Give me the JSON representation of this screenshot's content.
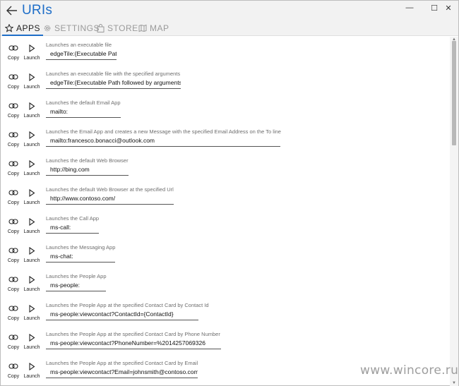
{
  "app": {
    "title": "URIs"
  },
  "window_controls": {
    "minimize": "—",
    "maximize": "☐",
    "close": "✕"
  },
  "tabs": [
    {
      "label": "APPS",
      "icon": "star-icon",
      "active": true
    },
    {
      "label": "SETTINGS",
      "icon": "gear-icon",
      "active": false
    },
    {
      "label": "STORE",
      "icon": "bag-icon",
      "active": false
    },
    {
      "label": "MAP",
      "icon": "map-icon",
      "active": false
    }
  ],
  "actions": {
    "copy_label": "Copy",
    "launch_label": "Launch"
  },
  "items": [
    {
      "description": "Launches an executable file",
      "uri": "edgeTile:{Executable Path}"
    },
    {
      "description": "Launches an executable file with the specified arguments",
      "uri": "edgeTile:{Executable Path followed by arguments}"
    },
    {
      "description": "Launches the default Email App",
      "uri": "mailto:"
    },
    {
      "description": "Launches the Email App and creates a new Message with the specified Email Address on the To line",
      "uri": "mailto:francesco.bonacci@outlook.com"
    },
    {
      "description": "Launches the default Web Browser",
      "uri": "http://bing.com"
    },
    {
      "description": "Launches the default Web Browser at the specified Url",
      "uri": "http://www.contoso.com/"
    },
    {
      "description": "Launches the Call App",
      "uri": "ms-call:"
    },
    {
      "description": "Launches the Messaging App",
      "uri": "ms-chat:"
    },
    {
      "description": "Launches the People App",
      "uri": "ms-people:"
    },
    {
      "description": "Launches the People App at the specified Contact Card by Contact Id",
      "uri": "ms-people:viewcontact?ContactId={ContactId}"
    },
    {
      "description": "Launches the People App at the specified Contact Card by Phone Number",
      "uri": "ms-people:viewcontact?PhoneNumber=%2014257069326"
    },
    {
      "description": "Launches the People App at the specified Contact Card by Email",
      "uri": "ms-people:viewcontact?Email=johnsmith@contoso.com"
    }
  ],
  "watermark": "www.wincore.ru"
}
